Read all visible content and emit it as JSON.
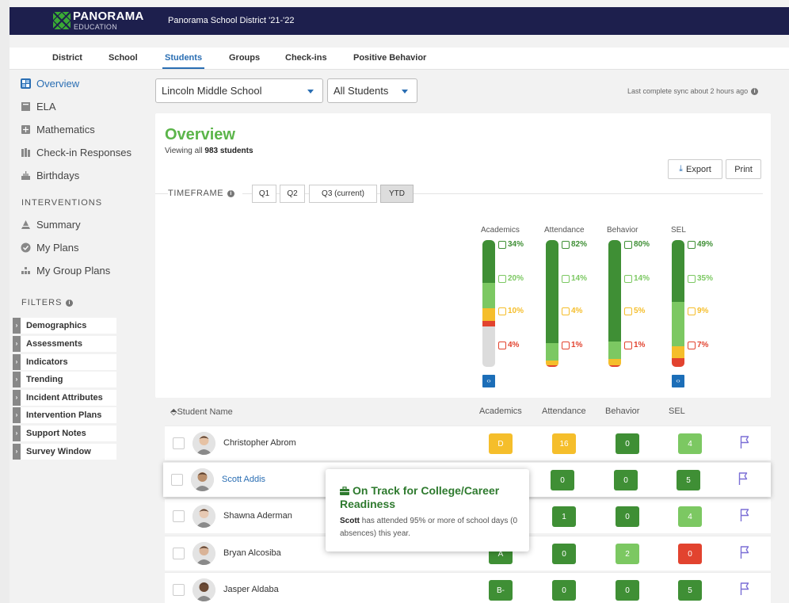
{
  "app": {
    "logo_name": "PANORAMA",
    "logo_sub": "EDUCATION",
    "district_title": "Panorama School District '21-'22"
  },
  "nav": {
    "tabs": [
      {
        "label": "District"
      },
      {
        "label": "School"
      },
      {
        "label": "Students",
        "active": true
      },
      {
        "label": "Groups"
      },
      {
        "label": "Check-ins"
      },
      {
        "label": "Positive Behavior"
      }
    ]
  },
  "sidebar": {
    "items": [
      {
        "label": "Overview",
        "icon": "overview-grid-icon",
        "active": true
      },
      {
        "label": "ELA",
        "icon": "book-icon"
      },
      {
        "label": "Mathematics",
        "icon": "calculator-icon"
      },
      {
        "label": "Check-in Responses",
        "icon": "books-icon"
      },
      {
        "label": "Birthdays",
        "icon": "cake-icon"
      }
    ],
    "interventions_heading": "INTERVENTIONS",
    "intervention_items": [
      {
        "label": "Summary",
        "icon": "pyramid-icon"
      },
      {
        "label": "My Plans",
        "icon": "check-circle-icon"
      },
      {
        "label": "My Group Plans",
        "icon": "group-icon"
      }
    ],
    "filters_heading": "FILTERS",
    "filters": [
      "Demographics",
      "Assessments",
      "Indicators",
      "Trending",
      "Incident Attributes",
      "Intervention Plans",
      "Support Notes",
      "Survey Window"
    ]
  },
  "selects": {
    "school": "Lincoln Middle School",
    "students": "All Students"
  },
  "sync_text": "Last complete sync about 2 hours ago",
  "overview": {
    "title": "Overview",
    "viewing_prefix": "Viewing all ",
    "viewing_count": "983 students",
    "export_label": "Export",
    "print_label": "Print",
    "timeframe_label": "TIMEFRAME",
    "timeframe_tabs": [
      {
        "label": "Q1"
      },
      {
        "label": "Q2"
      },
      {
        "label": "Q3 (current)"
      },
      {
        "label": "YTD",
        "active": true
      }
    ]
  },
  "colors": {
    "dark_green": "#3f8f35",
    "light_green": "#7cc862",
    "yellow": "#f5be2b",
    "red": "#e2432f",
    "gray": "#dcdcdc",
    "blue": "#2a6eb3",
    "navy": "#1d1f4d",
    "flag": "#7b6fd6"
  },
  "distribution": [
    {
      "title": "Academics",
      "segments": [
        34,
        20,
        10,
        4
      ],
      "labels": [
        "34%",
        "20%",
        "10%",
        "4%"
      ],
      "no_data": 32
    },
    {
      "title": "Attendance",
      "segments": [
        82,
        14,
        4,
        1
      ],
      "labels": [
        "82%",
        "14%",
        "4%",
        "1%"
      ],
      "no_data": 0
    },
    {
      "title": "Behavior",
      "segments": [
        80,
        14,
        5,
        1
      ],
      "labels": [
        "80%",
        "14%",
        "5%",
        "1%"
      ],
      "no_data": 0
    },
    {
      "title": "SEL",
      "segments": [
        49,
        35,
        9,
        7
      ],
      "labels": [
        "49%",
        "35%",
        "9%",
        "7%"
      ],
      "no_data": 0
    }
  ],
  "table": {
    "headers": {
      "name": "Student Name",
      "academics": "Academics",
      "attendance": "Attendance",
      "behavior": "Behavior",
      "sel": "SEL"
    },
    "rows": [
      {
        "name": "Christopher Abrom",
        "academics": {
          "value": "D",
          "color": "#f5be2b"
        },
        "attendance": {
          "value": "16",
          "color": "#f5be2b"
        },
        "behavior": {
          "value": "0",
          "color": "#3f8f35"
        },
        "sel": {
          "value": "4",
          "color": "#7cc862"
        }
      },
      {
        "name": "Scott Addis",
        "highlighted": true,
        "academics": {
          "value": "",
          "color": ""
        },
        "attendance": {
          "value": "0",
          "color": "#3f8f35"
        },
        "behavior": {
          "value": "0",
          "color": "#3f8f35"
        },
        "sel": {
          "value": "5",
          "color": "#3f8f35"
        }
      },
      {
        "name": "Shawna Aderman",
        "academics": {
          "value": "",
          "color": ""
        },
        "attendance": {
          "value": "1",
          "color": "#3f8f35"
        },
        "behavior": {
          "value": "0",
          "color": "#3f8f35"
        },
        "sel": {
          "value": "4",
          "color": "#7cc862"
        }
      },
      {
        "name": "Bryan Alcosiba",
        "academics": {
          "value": "A",
          "color": "#3f8f35"
        },
        "attendance": {
          "value": "0",
          "color": "#3f8f35"
        },
        "behavior": {
          "value": "2",
          "color": "#7cc862"
        },
        "sel": {
          "value": "0",
          "color": "#e2432f"
        }
      },
      {
        "name": "Jasper Aldaba",
        "academics": {
          "value": "B-",
          "color": "#3f8f35"
        },
        "attendance": {
          "value": "0",
          "color": "#3f8f35"
        },
        "behavior": {
          "value": "0",
          "color": "#3f8f35"
        },
        "sel": {
          "value": "5",
          "color": "#3f8f35"
        }
      }
    ]
  },
  "tooltip": {
    "title": "On Track for College/Career Readiness",
    "icon": "briefcase-icon",
    "body_name": "Scott",
    "body_text": " has attended 95% or more of school days (0 absences) this year."
  }
}
